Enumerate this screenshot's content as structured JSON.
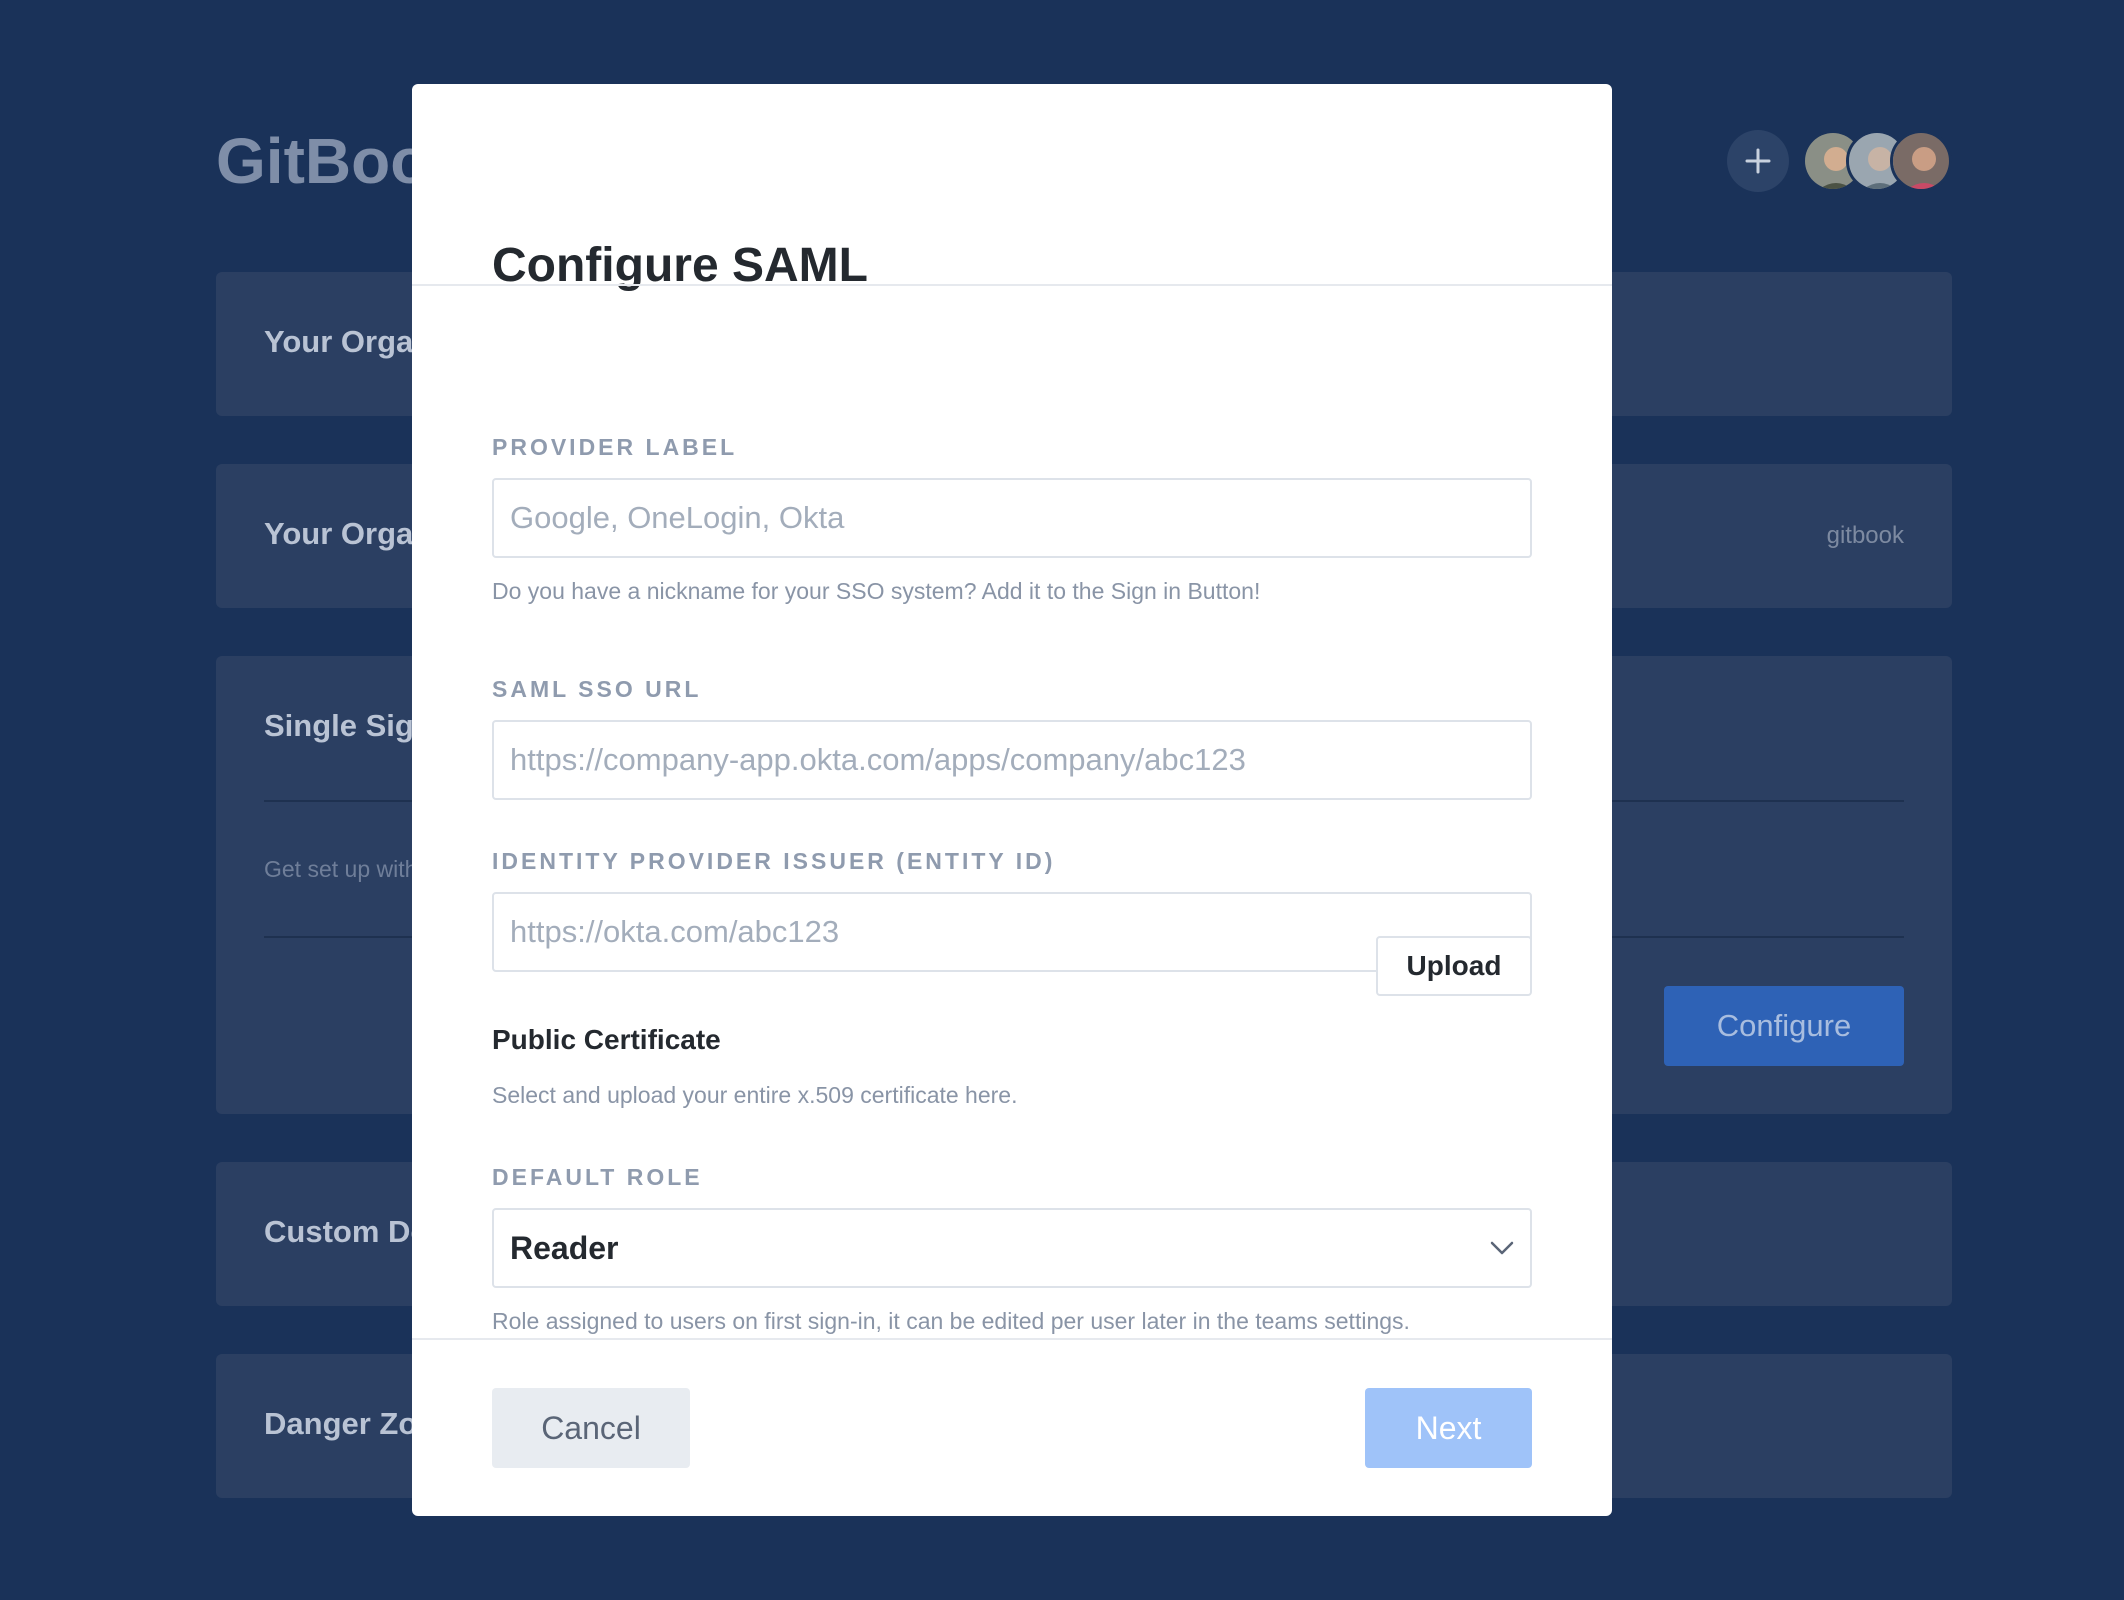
{
  "background": {
    "app_title": "GitBook",
    "add_icon": "plus-icon",
    "cards": [
      {
        "title": "Your Organization Name"
      },
      {
        "title": "Your Organization URL",
        "side_text": "gitbook"
      },
      {
        "title": "Single Sign-On",
        "subtitle": "Get set up with SAML",
        "button_label": "Configure"
      },
      {
        "title": "Custom Domain"
      },
      {
        "title": "Danger Zone"
      }
    ]
  },
  "modal": {
    "title": "Configure SAML",
    "provider_label": {
      "label": "PROVIDER LABEL",
      "placeholder": "Google, OneLogin, Okta",
      "value": "",
      "help": "Do you have a nickname for your SSO system? Add it to the Sign in Button!"
    },
    "sso_url": {
      "label": "SAML SSO URL",
      "placeholder": "https://company-app.okta.com/apps/company/abc123",
      "value": ""
    },
    "issuer": {
      "label": "IDENTITY PROVIDER ISSUER (ENTITY ID)",
      "placeholder": "https://okta.com/abc123",
      "value": ""
    },
    "certificate": {
      "title": "Public Certificate",
      "help": "Select and upload your entire x.509 certificate here.",
      "upload_label": "Upload"
    },
    "default_role": {
      "label": "DEFAULT ROLE",
      "value": "Reader",
      "help": "Role assigned to users on first sign-in, it can be edited per user later in the teams settings.",
      "icon": "chevron-down-icon"
    },
    "footer": {
      "cancel_label": "Cancel",
      "next_label": "Next"
    }
  },
  "colors": {
    "backdrop": "#1a3259",
    "card": "#2b3f62",
    "primary": "#2e62b6",
    "next_disabled": "#9fc3f9"
  }
}
